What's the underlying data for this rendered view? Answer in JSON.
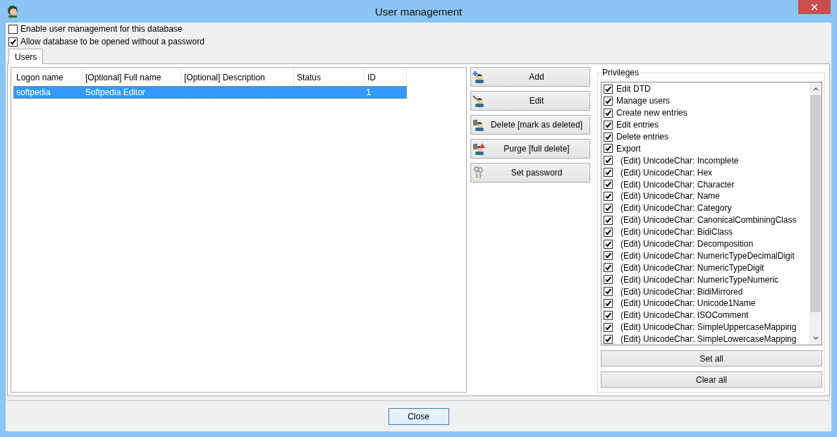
{
  "window": {
    "title": "User management"
  },
  "options": [
    {
      "label": "Enable user management for this database",
      "checked": false
    },
    {
      "label": "Allow database to be opened without a password",
      "checked": true
    }
  ],
  "tabs": [
    {
      "label": "Users",
      "selected": true
    }
  ],
  "table": {
    "columns": [
      "Logon name",
      "[Optional] Full name",
      "[Optional] Description",
      "Status",
      "ID"
    ],
    "rows": [
      {
        "cells": [
          "softpedia",
          "Softpedia Editor",
          "",
          "",
          "1"
        ],
        "selected": true
      }
    ]
  },
  "actions": [
    {
      "label": "Add",
      "kind": "add"
    },
    {
      "label": "Edit",
      "kind": "edit"
    },
    {
      "label": "Delete [mark as deleted]",
      "kind": "delete"
    },
    {
      "label": "Purge [full delete]",
      "kind": "purge"
    },
    {
      "label": "Set password",
      "kind": "password"
    }
  ],
  "privileges": {
    "title": "Privileges",
    "items": [
      {
        "label": "Edit DTD",
        "checked": true,
        "kind": "general"
      },
      {
        "label": "Manage users",
        "checked": true,
        "kind": "general"
      },
      {
        "label": "Create new entries",
        "checked": true,
        "kind": "general"
      },
      {
        "label": "Edit entries",
        "checked": true,
        "kind": "general"
      },
      {
        "label": "Delete entries",
        "checked": true,
        "kind": "general"
      },
      {
        "label": "Export",
        "checked": true,
        "kind": "general"
      },
      {
        "label": "(Edit) UnicodeChar: Incomplete",
        "checked": true,
        "kind": "field"
      },
      {
        "label": "(Edit) UnicodeChar: Hex",
        "checked": true,
        "kind": "field"
      },
      {
        "label": "(Edit) UnicodeChar: Character",
        "checked": true,
        "kind": "field"
      },
      {
        "label": "(Edit) UnicodeChar: Name",
        "checked": true,
        "kind": "field"
      },
      {
        "label": "(Edit) UnicodeChar: Category",
        "checked": true,
        "kind": "field"
      },
      {
        "label": "(Edit) UnicodeChar: CanonicalCombiningClass",
        "checked": true,
        "kind": "field"
      },
      {
        "label": "(Edit) UnicodeChar: BidiClass",
        "checked": true,
        "kind": "field"
      },
      {
        "label": "(Edit) UnicodeChar: Decomposition",
        "checked": true,
        "kind": "field"
      },
      {
        "label": "(Edit) UnicodeChar: NumericTypeDecimalDigit",
        "checked": true,
        "kind": "field"
      },
      {
        "label": "(Edit) UnicodeChar: NumericTypeDigit",
        "checked": true,
        "kind": "field"
      },
      {
        "label": "(Edit) UnicodeChar: NumericTypeNumeric",
        "checked": true,
        "kind": "field"
      },
      {
        "label": "(Edit) UnicodeChar: BidiMirrored",
        "checked": true,
        "kind": "field"
      },
      {
        "label": "(Edit) UnicodeChar: Unicode1Name",
        "checked": true,
        "kind": "field"
      },
      {
        "label": "(Edit) UnicodeChar: ISOComment",
        "checked": true,
        "kind": "field"
      },
      {
        "label": "(Edit) UnicodeChar: SimpleUppercaseMapping",
        "checked": true,
        "kind": "field"
      },
      {
        "label": "(Edit) UnicodeChar: SimpleLowercaseMapping",
        "checked": true,
        "kind": "field"
      }
    ],
    "buttons": [
      "Set all",
      "Clear all"
    ]
  },
  "footer": {
    "button": "Close"
  }
}
